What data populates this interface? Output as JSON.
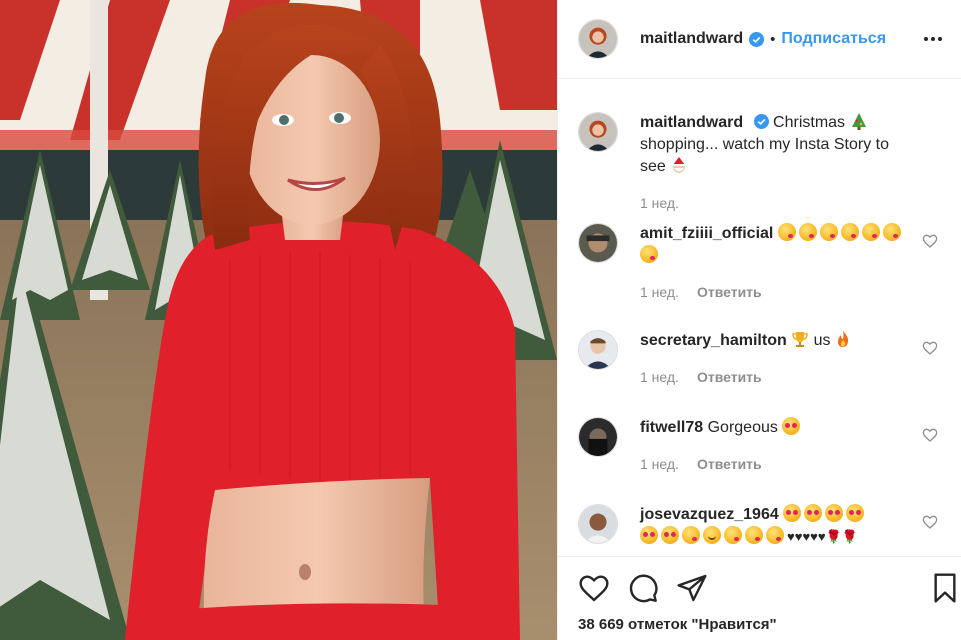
{
  "post": {
    "author": "maitlandward",
    "follow_label": "Подписаться",
    "separator": "•"
  },
  "caption": {
    "username": "maitlandward",
    "text_part1": "Christmas",
    "text_part2": "shopping... watch my Insta Story to see",
    "time": "1 нед."
  },
  "comments": [
    {
      "username": "amit_fziiii_official",
      "text": "",
      "time": "1 нед.",
      "reply": "Ответить"
    },
    {
      "username": "secretary_hamilton",
      "text": "us",
      "time": "1 нед.",
      "reply": "Ответить"
    },
    {
      "username": "fitwell78",
      "text": "Gorgeous",
      "time": "1 нед.",
      "reply": "Ответить"
    },
    {
      "username": "josevazquez_1964",
      "text": "",
      "time": "",
      "reply": ""
    }
  ],
  "likes": {
    "text": "38 669 отметок \"Нравится\""
  },
  "colors": {
    "accent": "#3897f0",
    "text": "#262626",
    "muted": "#8e8e8e",
    "shirt": "#e0202a"
  }
}
